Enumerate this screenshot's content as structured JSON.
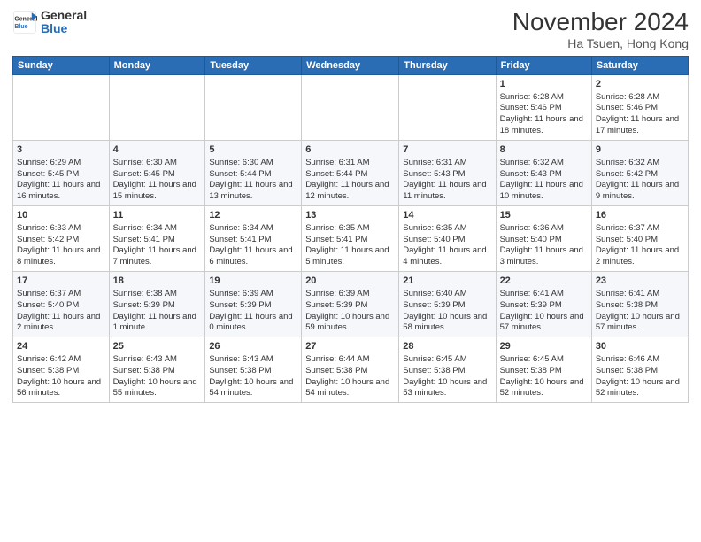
{
  "logo": {
    "line1": "General",
    "line2": "Blue"
  },
  "title": "November 2024",
  "subtitle": "Ha Tsuen, Hong Kong",
  "days_of_week": [
    "Sunday",
    "Monday",
    "Tuesday",
    "Wednesday",
    "Thursday",
    "Friday",
    "Saturday"
  ],
  "weeks": [
    [
      {
        "day": "",
        "info": ""
      },
      {
        "day": "",
        "info": ""
      },
      {
        "day": "",
        "info": ""
      },
      {
        "day": "",
        "info": ""
      },
      {
        "day": "",
        "info": ""
      },
      {
        "day": "1",
        "info": "Sunrise: 6:28 AM\nSunset: 5:46 PM\nDaylight: 11 hours and 18 minutes."
      },
      {
        "day": "2",
        "info": "Sunrise: 6:28 AM\nSunset: 5:46 PM\nDaylight: 11 hours and 17 minutes."
      }
    ],
    [
      {
        "day": "3",
        "info": "Sunrise: 6:29 AM\nSunset: 5:45 PM\nDaylight: 11 hours and 16 minutes."
      },
      {
        "day": "4",
        "info": "Sunrise: 6:30 AM\nSunset: 5:45 PM\nDaylight: 11 hours and 15 minutes."
      },
      {
        "day": "5",
        "info": "Sunrise: 6:30 AM\nSunset: 5:44 PM\nDaylight: 11 hours and 13 minutes."
      },
      {
        "day": "6",
        "info": "Sunrise: 6:31 AM\nSunset: 5:44 PM\nDaylight: 11 hours and 12 minutes."
      },
      {
        "day": "7",
        "info": "Sunrise: 6:31 AM\nSunset: 5:43 PM\nDaylight: 11 hours and 11 minutes."
      },
      {
        "day": "8",
        "info": "Sunrise: 6:32 AM\nSunset: 5:43 PM\nDaylight: 11 hours and 10 minutes."
      },
      {
        "day": "9",
        "info": "Sunrise: 6:32 AM\nSunset: 5:42 PM\nDaylight: 11 hours and 9 minutes."
      }
    ],
    [
      {
        "day": "10",
        "info": "Sunrise: 6:33 AM\nSunset: 5:42 PM\nDaylight: 11 hours and 8 minutes."
      },
      {
        "day": "11",
        "info": "Sunrise: 6:34 AM\nSunset: 5:41 PM\nDaylight: 11 hours and 7 minutes."
      },
      {
        "day": "12",
        "info": "Sunrise: 6:34 AM\nSunset: 5:41 PM\nDaylight: 11 hours and 6 minutes."
      },
      {
        "day": "13",
        "info": "Sunrise: 6:35 AM\nSunset: 5:41 PM\nDaylight: 11 hours and 5 minutes."
      },
      {
        "day": "14",
        "info": "Sunrise: 6:35 AM\nSunset: 5:40 PM\nDaylight: 11 hours and 4 minutes."
      },
      {
        "day": "15",
        "info": "Sunrise: 6:36 AM\nSunset: 5:40 PM\nDaylight: 11 hours and 3 minutes."
      },
      {
        "day": "16",
        "info": "Sunrise: 6:37 AM\nSunset: 5:40 PM\nDaylight: 11 hours and 2 minutes."
      }
    ],
    [
      {
        "day": "17",
        "info": "Sunrise: 6:37 AM\nSunset: 5:40 PM\nDaylight: 11 hours and 2 minutes."
      },
      {
        "day": "18",
        "info": "Sunrise: 6:38 AM\nSunset: 5:39 PM\nDaylight: 11 hours and 1 minute."
      },
      {
        "day": "19",
        "info": "Sunrise: 6:39 AM\nSunset: 5:39 PM\nDaylight: 11 hours and 0 minutes."
      },
      {
        "day": "20",
        "info": "Sunrise: 6:39 AM\nSunset: 5:39 PM\nDaylight: 10 hours and 59 minutes."
      },
      {
        "day": "21",
        "info": "Sunrise: 6:40 AM\nSunset: 5:39 PM\nDaylight: 10 hours and 58 minutes."
      },
      {
        "day": "22",
        "info": "Sunrise: 6:41 AM\nSunset: 5:39 PM\nDaylight: 10 hours and 57 minutes."
      },
      {
        "day": "23",
        "info": "Sunrise: 6:41 AM\nSunset: 5:38 PM\nDaylight: 10 hours and 57 minutes."
      }
    ],
    [
      {
        "day": "24",
        "info": "Sunrise: 6:42 AM\nSunset: 5:38 PM\nDaylight: 10 hours and 56 minutes."
      },
      {
        "day": "25",
        "info": "Sunrise: 6:43 AM\nSunset: 5:38 PM\nDaylight: 10 hours and 55 minutes."
      },
      {
        "day": "26",
        "info": "Sunrise: 6:43 AM\nSunset: 5:38 PM\nDaylight: 10 hours and 54 minutes."
      },
      {
        "day": "27",
        "info": "Sunrise: 6:44 AM\nSunset: 5:38 PM\nDaylight: 10 hours and 54 minutes."
      },
      {
        "day": "28",
        "info": "Sunrise: 6:45 AM\nSunset: 5:38 PM\nDaylight: 10 hours and 53 minutes."
      },
      {
        "day": "29",
        "info": "Sunrise: 6:45 AM\nSunset: 5:38 PM\nDaylight: 10 hours and 52 minutes."
      },
      {
        "day": "30",
        "info": "Sunrise: 6:46 AM\nSunset: 5:38 PM\nDaylight: 10 hours and 52 minutes."
      }
    ]
  ]
}
